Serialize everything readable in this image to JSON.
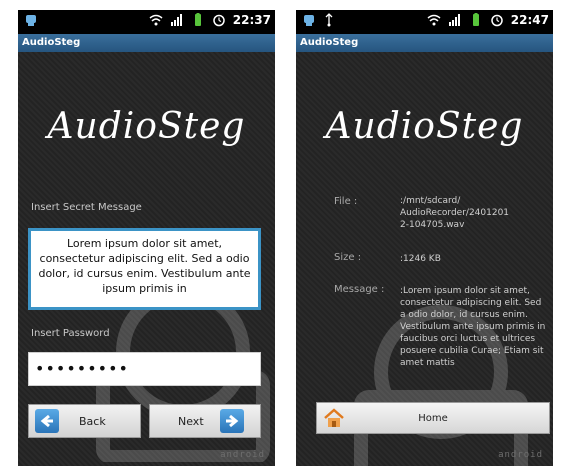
{
  "screens": [
    {
      "status": {
        "time": "22:37"
      },
      "app_title": "AudioSteg",
      "logo_text": "AudioSteg",
      "secret_label": "Insert Secret Message",
      "message_text": "Lorem ipsum dolor sit amet, consectetur adipiscing elit. Sed a odio dolor, id cursus enim. Vestibulum ante ipsum primis in",
      "password_label": "Insert Password",
      "password_value": "•••••••••",
      "back_label": "Back",
      "next_label": "Next",
      "android_text": "android"
    },
    {
      "status": {
        "time": "22:47"
      },
      "app_title": "AudioSteg",
      "logo_text": "AudioSteg",
      "file_label": "File :",
      "file_value": ":/mnt/sdcard/ AudioRecorder/2401201 2-104705.wav",
      "size_label": "Size :",
      "size_value": ":1246 KB",
      "message_label": "Message :",
      "message_value": ":Lorem ipsum dolor sit amet, consectetur adipiscing elit. Sed a odio dolor, id cursus enim. Vestibulum ante ipsum primis in faucibus orci luctus et ultrices posuere cubilia Curae; Etiam sit amet mattis",
      "home_label": "Home",
      "android_text": "android"
    }
  ],
  "colors": {
    "titlebar": "#2f6590",
    "accent_border": "#3b93c6",
    "arrow_blue": "#2a74b8"
  }
}
